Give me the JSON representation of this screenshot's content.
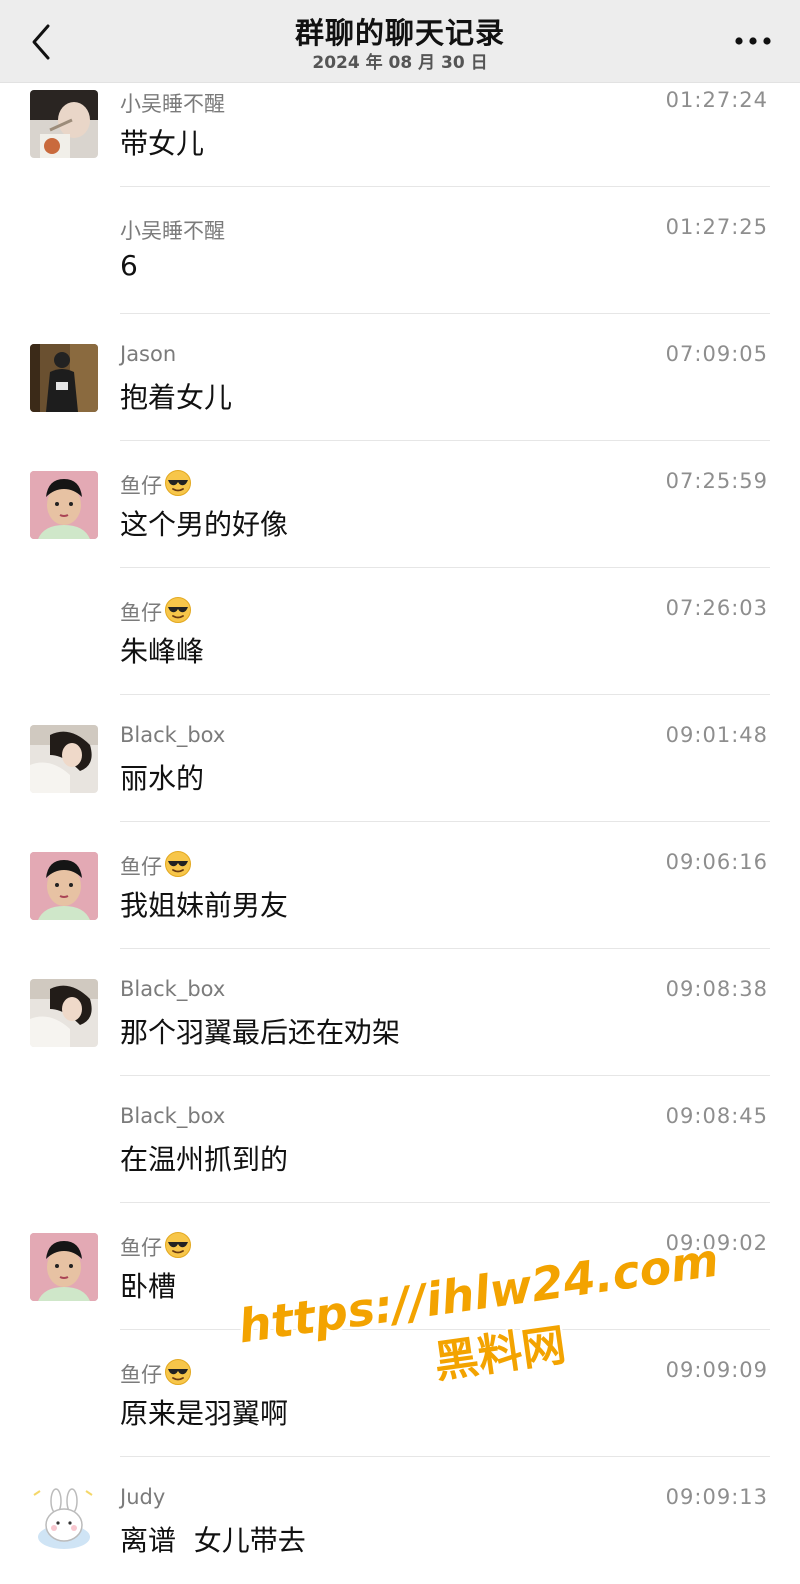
{
  "header": {
    "title": "群聊的聊天记录",
    "date": "2024 年 08 月 30 日"
  },
  "colors": {
    "topbar_bg": "#ededed",
    "watermark": "#f3a300"
  },
  "messages": [
    {
      "sender": "小吴睡不醒",
      "time": "01:27:24",
      "text": "带女儿",
      "show_avatar": true,
      "avatar": "avatar-wu"
    },
    {
      "sender": "小吴睡不醒",
      "time": "01:27:25",
      "text": "6",
      "show_avatar": false
    },
    {
      "sender": "Jason",
      "time": "07:09:05",
      "text": "抱着女儿",
      "show_avatar": true,
      "avatar": "avatar-jason"
    },
    {
      "sender": "鱼仔",
      "time": "07:25:59",
      "text": "这个男的好像",
      "show_avatar": true,
      "avatar": "avatar-yuzai",
      "emoji": "sunglasses-emoji"
    },
    {
      "sender": "鱼仔",
      "time": "07:26:03",
      "text": "朱峰峰",
      "show_avatar": false,
      "emoji": "sunglasses-emoji"
    },
    {
      "sender": "Black_box",
      "time": "09:01:48",
      "text": "丽水的",
      "show_avatar": true,
      "avatar": "avatar-blackbox"
    },
    {
      "sender": "鱼仔",
      "time": "09:06:16",
      "text": "我姐妹前男友",
      "show_avatar": true,
      "avatar": "avatar-yuzai",
      "emoji": "sunglasses-emoji"
    },
    {
      "sender": "Black_box",
      "time": "09:08:38",
      "text": "那个羽翼最后还在劝架",
      "show_avatar": true,
      "avatar": "avatar-blackbox"
    },
    {
      "sender": "Black_box",
      "time": "09:08:45",
      "text": "在温州抓到的",
      "show_avatar": false
    },
    {
      "sender": "鱼仔",
      "time": "09:09:02",
      "text": "卧槽",
      "show_avatar": true,
      "avatar": "avatar-yuzai",
      "emoji": "sunglasses-emoji"
    },
    {
      "sender": "鱼仔",
      "time": "09:09:09",
      "text": "原来是羽翼啊",
      "show_avatar": false,
      "emoji": "sunglasses-emoji"
    },
    {
      "sender": "Judy",
      "time": "09:09:13",
      "text": "离谱  女儿带去",
      "show_avatar": true,
      "avatar": "avatar-judy"
    }
  ],
  "watermark": {
    "url": "https://ihlw24.com",
    "name": "黑料网"
  }
}
